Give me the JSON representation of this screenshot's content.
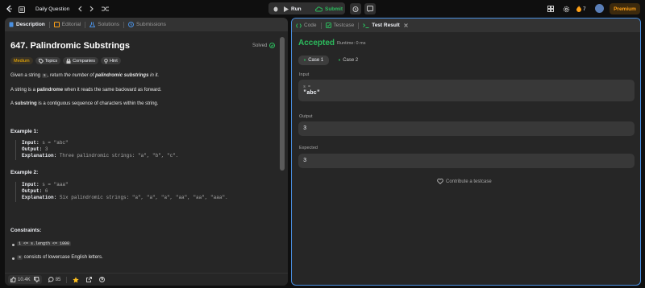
{
  "topbar": {
    "title": "Daily Question",
    "run_label": "Run",
    "submit_label": "Submit",
    "streak_count": "7",
    "premium_label": "Premium"
  },
  "left": {
    "tabs": [
      "Description",
      "Editorial",
      "Solutions",
      "Submissions"
    ],
    "problem_title": "647. Palindromic Substrings",
    "solved_label": "Solved",
    "tags": [
      "Medium",
      "Topics",
      "Companies",
      "Hint"
    ],
    "p1_a": "Given a string ",
    "p1_code": "s",
    "p1_b": ", return ",
    "p1_c": "the number of ",
    "p1_d": "palindromic substrings",
    "p1_e": " in it.",
    "p2_a": "A string is a ",
    "p2_b": "palindrome",
    "p2_c": " when it reads the same backward as forward.",
    "p3_a": "A ",
    "p3_b": "substring",
    "p3_c": " is a contiguous sequence of characters within the string.",
    "example1": {
      "title": "Example 1:",
      "input_label": "Input:",
      "input": "s = \"abc\"",
      "output_label": "Output:",
      "output": "3",
      "expl_label": "Explanation:",
      "expl": "Three palindromic strings: \"a\", \"b\", \"c\"."
    },
    "example2": {
      "title": "Example 2:",
      "input_label": "Input:",
      "input": "s = \"aaa\"",
      "output_label": "Output:",
      "output": "6",
      "expl_label": "Explanation:",
      "expl": "Six palindromic strings: \"a\", \"a\", \"a\", \"aa\", \"aa\", \"aaa\"."
    },
    "constraints_title": "Constraints:",
    "c1": "1 <= s.length <= 1000",
    "c2_code": "s",
    "c2_text": " consists of lowercase English letters.",
    "footer": {
      "likes": "10.4K",
      "comments": "85"
    }
  },
  "right": {
    "tabs": [
      "Code",
      "Testcase",
      "Test Result"
    ],
    "status": "Accepted",
    "runtime": "Runtime: 0 ms",
    "cases": [
      "Case 1",
      "Case 2"
    ],
    "input_label": "Input",
    "input_var": "s =",
    "input_value": "\"abc\"",
    "output_label": "Output",
    "output_value": "3",
    "expected_label": "Expected",
    "expected_value": "3",
    "contribute": "Contribute a testcase"
  },
  "colors": {
    "accent": "#ffa116",
    "accepted": "#2cbb5d",
    "focus_border": "#4a90e2"
  }
}
